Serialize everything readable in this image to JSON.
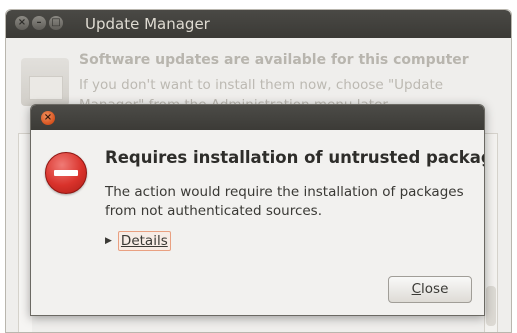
{
  "background_window": {
    "title": "Update Manager",
    "heading": "Software updates are available for this computer",
    "subtext": "If you don't want to install them now, choose \"Update Manager\" from the Administration menu later."
  },
  "dialog": {
    "heading": "Requires installation of untrusted packages",
    "message": "The action would require the installation of packages from not authenticated sources.",
    "details_label": "Details",
    "close_button_label": "Close",
    "close_button_mnemonic": "C",
    "close_button_rest": "lose"
  },
  "colors": {
    "titlebar": "#3c3b37",
    "dialog_bg": "#f2f1ef",
    "stop_icon": "#d9322b",
    "close_accent": "#d6521e"
  },
  "icons": {
    "wm_close": "close-icon",
    "wm_minimize": "minimize-icon",
    "wm_maximize": "maximize-icon",
    "error": "stop-icon",
    "expander": "triangle-right-icon"
  }
}
